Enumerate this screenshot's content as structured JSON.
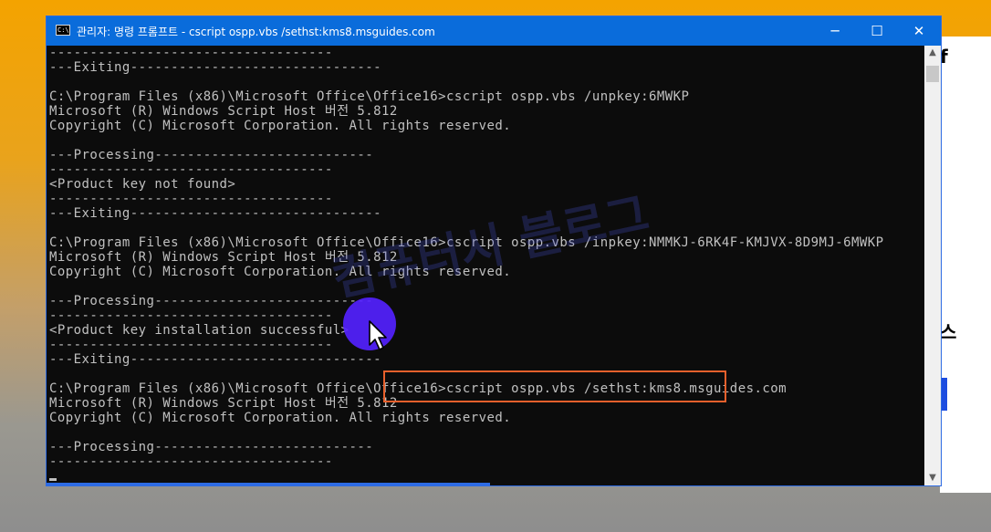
{
  "window": {
    "title": "관리자: 명령 프롬프트 - cscript  ospp.vbs /sethst:kms8.msguides.com",
    "icon_label": "C:\\",
    "controls": {
      "minimize": "─",
      "maximize": "☐",
      "close": "✕"
    }
  },
  "console": {
    "lines": [
      "-----------------------------------",
      "---Exiting-------------------------------",
      "",
      "C:\\Program Files (x86)\\Microsoft Office\\Office16>cscript ospp.vbs /unpkey:6MWKP",
      "Microsoft (R) Windows Script Host 버전 5.812",
      "Copyright (C) Microsoft Corporation. All rights reserved.",
      "",
      "---Processing---------------------------",
      "-----------------------------------",
      "<Product key not found>",
      "-----------------------------------",
      "---Exiting-------------------------------",
      "",
      "C:\\Program Files (x86)\\Microsoft Office\\Office16>cscript ospp.vbs /inpkey:NMMKJ-6RK4F-KMJVX-8D9MJ-6MWKP",
      "Microsoft (R) Windows Script Host 버전 5.812",
      "Copyright (C) Microsoft Corporation. All rights reserved.",
      "",
      "---Processing---------------------------",
      "-----------------------------------",
      "<Product key installation successful>",
      "-----------------------------------",
      "---Exiting-------------------------------",
      "",
      "C:\\Program Files (x86)\\Microsoft Office\\Office16>cscript ospp.vbs /sethst:kms8.msguides.com",
      "Microsoft (R) Windows Script Host 버전 5.812",
      "Copyright (C) Microsoft Corporation. All rights reserved.",
      "",
      "---Processing---------------------------",
      "-----------------------------------"
    ]
  },
  "annotation": {
    "watermark": "컴퓨터시 블로그"
  },
  "colors": {
    "titlebar": "#0a6cdb",
    "console_bg": "#0c0c0c",
    "console_text": "#c0c0c0",
    "highlight": "#e8602c",
    "click_indicator": "#5422ff"
  },
  "icons": {
    "cmd": "cmd-icon",
    "pointer": "mouse-pointer-icon",
    "scroll_up": "chevron-up-icon",
    "scroll_down": "chevron-down-icon"
  }
}
